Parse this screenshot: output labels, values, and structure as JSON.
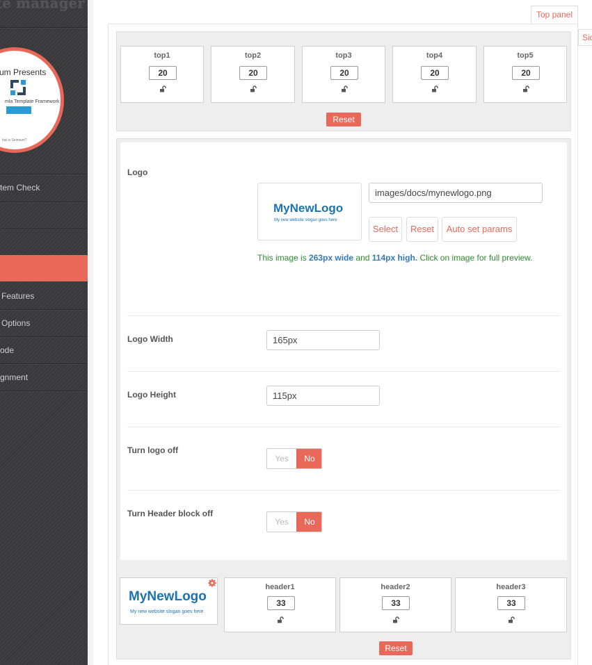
{
  "sidebar": {
    "app_title": "te manager",
    "promo": {
      "presents": "um Presents",
      "framework": "mla Template Framework",
      "what": "hat is Seimium?"
    },
    "items": [
      {
        "label": "tem Check"
      },
      {
        "label": ""
      },
      {
        "label": ""
      },
      {
        "label": ""
      },
      {
        "label": "Features"
      },
      {
        "label": "Options"
      },
      {
        "label": "ode"
      },
      {
        "label": "gnment"
      }
    ]
  },
  "tabs": {
    "top_panel": "Top panel",
    "side": "Sid"
  },
  "top_positions": [
    {
      "name": "top1",
      "value": "20"
    },
    {
      "name": "top2",
      "value": "20"
    },
    {
      "name": "top3",
      "value": "20"
    },
    {
      "name": "top4",
      "value": "20"
    },
    {
      "name": "top5",
      "value": "20"
    }
  ],
  "reset_label": "Reset",
  "logo": {
    "label": "Logo",
    "path": "images/docs/mynewlogo.png",
    "brand": "MyNewLogo",
    "slogan": "My new website slogan goes here",
    "select_label": "Select",
    "reset_label": "Reset",
    "auto_label": "Auto set params",
    "info": {
      "pre": "This image is ",
      "width": "263px wide",
      "mid": " and ",
      "height": "114px high.",
      "post": " Click on image for full preview."
    }
  },
  "logo_width": {
    "label": "Logo Width",
    "value": "165px"
  },
  "logo_height": {
    "label": "Logo Height",
    "value": "115px"
  },
  "turn_logo_off": {
    "label": "Turn logo off",
    "yes": "Yes",
    "no": "No"
  },
  "turn_header_off": {
    "label": "Turn Header block off",
    "yes": "Yes",
    "no": "No"
  },
  "header_positions": [
    {
      "name": "header1",
      "value": "33"
    },
    {
      "name": "header2",
      "value": "33"
    },
    {
      "name": "header3",
      "value": "33"
    }
  ],
  "colors": {
    "accent": "#e8685a",
    "brand_blue": "#1b73b3",
    "info_green": "#2e8c2e"
  }
}
